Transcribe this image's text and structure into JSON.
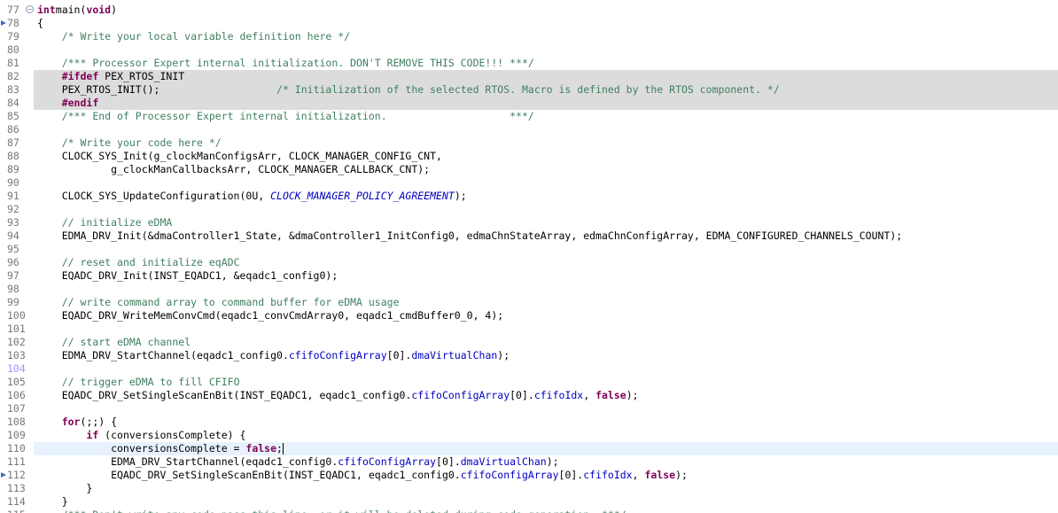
{
  "editor": {
    "colors": {
      "keyword": "#7f0055",
      "comment": "#3f7f5f",
      "macro": "#0000c0",
      "inactive_bg": "#dcdcdc",
      "current_line_bg": "#e8f2fe"
    },
    "lines": [
      {
        "num": "77",
        "fold": "⊖",
        "segments": [
          [
            "kw",
            "int"
          ],
          [
            "",
            "main("
          ],
          [
            "kw",
            "void"
          ],
          [
            "",
            ")"
          ]
        ]
      },
      {
        "num": "78",
        "marker": true,
        "segments": [
          [
            "",
            "{"
          ]
        ]
      },
      {
        "num": "79",
        "segments": [
          [
            "",
            "    "
          ],
          [
            "cm",
            "/* Write your local variable definition here */"
          ]
        ]
      },
      {
        "num": "80",
        "segments": []
      },
      {
        "num": "81",
        "segments": [
          [
            "",
            "    "
          ],
          [
            "cm",
            "/*** Processor Expert internal initialization. DON'T REMOVE THIS CODE!!! ***/"
          ]
        ]
      },
      {
        "num": "82",
        "inactive": true,
        "segments": [
          [
            "",
            "    "
          ],
          [
            "dir",
            "#ifdef"
          ],
          [
            "",
            " PEX_RTOS_INIT"
          ]
        ]
      },
      {
        "num": "83",
        "inactive": true,
        "segments": [
          [
            "",
            "    PEX_RTOS_INIT();                   "
          ],
          [
            "cm",
            "/* Initialization of the selected RTOS. Macro is defined by the RTOS component. */"
          ]
        ]
      },
      {
        "num": "84",
        "inactive": true,
        "segments": [
          [
            "",
            "    "
          ],
          [
            "dir",
            "#endif"
          ]
        ]
      },
      {
        "num": "85",
        "segments": [
          [
            "",
            "    "
          ],
          [
            "cm",
            "/*** End of Processor Expert internal initialization.                    ***/"
          ]
        ]
      },
      {
        "num": "86",
        "segments": []
      },
      {
        "num": "87",
        "segments": [
          [
            "",
            "    "
          ],
          [
            "cm",
            "/* Write your code here */"
          ]
        ]
      },
      {
        "num": "88",
        "segments": [
          [
            "",
            "    CLOCK_SYS_Init(g_clockManConfigsArr, CLOCK_MANAGER_CONFIG_CNT,"
          ]
        ]
      },
      {
        "num": "89",
        "segments": [
          [
            "",
            "            g_clockManCallbacksArr, CLOCK_MANAGER_CALLBACK_CNT);"
          ]
        ]
      },
      {
        "num": "90",
        "segments": []
      },
      {
        "num": "91",
        "segments": [
          [
            "",
            "    CLOCK_SYS_UpdateConfiguration(0U, "
          ],
          [
            "mac",
            "CLOCK_MANAGER_POLICY_AGREEMENT"
          ],
          [
            "",
            ");"
          ]
        ]
      },
      {
        "num": "92",
        "segments": []
      },
      {
        "num": "93",
        "segments": [
          [
            "",
            "    "
          ],
          [
            "cm",
            "// initialize eDMA"
          ]
        ]
      },
      {
        "num": "94",
        "segments": [
          [
            "",
            "    EDMA_DRV_Init(&dmaController1_State, &dmaController1_InitConfig0, edmaChnStateArray, edmaChnConfigArray, EDMA_CONFIGURED_CHANNELS_COUNT);"
          ]
        ]
      },
      {
        "num": "95",
        "segments": []
      },
      {
        "num": "96",
        "segments": [
          [
            "",
            "    "
          ],
          [
            "cm",
            "// reset and initialize eqADC"
          ]
        ]
      },
      {
        "num": "97",
        "segments": [
          [
            "",
            "    EQADC_DRV_Init(INST_EQADC1, &eqadc1_config0);"
          ]
        ]
      },
      {
        "num": "98",
        "segments": []
      },
      {
        "num": "99",
        "segments": [
          [
            "",
            "    "
          ],
          [
            "cm",
            "// write command array to command buffer for eDMA usage"
          ]
        ]
      },
      {
        "num": "100",
        "segments": [
          [
            "",
            "    EQADC_DRV_WriteMemConvCmd(eqadc1_convCmdArray0, eqadc1_cmdBuffer0_0, 4);"
          ]
        ]
      },
      {
        "num": "101",
        "segments": []
      },
      {
        "num": "102",
        "segments": [
          [
            "",
            "    "
          ],
          [
            "cm",
            "// start eDMA channel"
          ]
        ]
      },
      {
        "num": "103",
        "segments": [
          [
            "",
            "    EDMA_DRV_StartChannel(eqadc1_config0."
          ],
          [
            "fld",
            "cfifoConfigArray"
          ],
          [
            "",
            "[0]."
          ],
          [
            "fld",
            "dmaVirtualChan"
          ],
          [
            "",
            ");"
          ]
        ]
      },
      {
        "num": "104",
        "sel": true,
        "segments": []
      },
      {
        "num": "105",
        "segments": [
          [
            "",
            "    "
          ],
          [
            "cm",
            "// trigger eDMA to fill CFIFO"
          ]
        ]
      },
      {
        "num": "106",
        "segments": [
          [
            "",
            "    EQADC_DRV_SetSingleScanEnBit(INST_EQADC1, eqadc1_config0."
          ],
          [
            "fld",
            "cfifoConfigArray"
          ],
          [
            "",
            "[0]."
          ],
          [
            "fld",
            "cfifoIdx"
          ],
          [
            "",
            ", "
          ],
          [
            "kw",
            "false"
          ],
          [
            "",
            ");"
          ]
        ]
      },
      {
        "num": "107",
        "segments": []
      },
      {
        "num": "108",
        "segments": [
          [
            "",
            "    "
          ],
          [
            "kw",
            "for"
          ],
          [
            "",
            "(;;) {"
          ]
        ]
      },
      {
        "num": "109",
        "segments": [
          [
            "",
            "        "
          ],
          [
            "kw",
            "if"
          ],
          [
            "",
            " (conversionsComplete) {"
          ]
        ]
      },
      {
        "num": "110",
        "current": true,
        "caret": true,
        "segments": [
          [
            "",
            "            conversionsComplete = "
          ],
          [
            "kw",
            "false"
          ],
          [
            "",
            ";"
          ]
        ]
      },
      {
        "num": "111",
        "segments": [
          [
            "",
            "            EDMA_DRV_StartChannel(eqadc1_config0."
          ],
          [
            "fld",
            "cfifoConfigArray"
          ],
          [
            "",
            "[0]."
          ],
          [
            "fld",
            "dmaVirtualChan"
          ],
          [
            "",
            ");"
          ]
        ]
      },
      {
        "num": "112",
        "marker": true,
        "segments": [
          [
            "",
            "            EQADC_DRV_SetSingleScanEnBit(INST_EQADC1, eqadc1_config0."
          ],
          [
            "fld",
            "cfifoConfigArray"
          ],
          [
            "",
            "[0]."
          ],
          [
            "fld",
            "cfifoIdx"
          ],
          [
            "",
            ", "
          ],
          [
            "kw",
            "false"
          ],
          [
            "",
            ");"
          ]
        ]
      },
      {
        "num": "113",
        "segments": [
          [
            "",
            "        }"
          ]
        ]
      },
      {
        "num": "114",
        "segments": [
          [
            "",
            "    }"
          ]
        ]
      },
      {
        "num": "115",
        "clip": true,
        "segments": [
          [
            "",
            "    "
          ],
          [
            "cm",
            "/*** Don't write any code pass this line, or it will be deleted during code generation. ***/"
          ]
        ]
      }
    ]
  }
}
